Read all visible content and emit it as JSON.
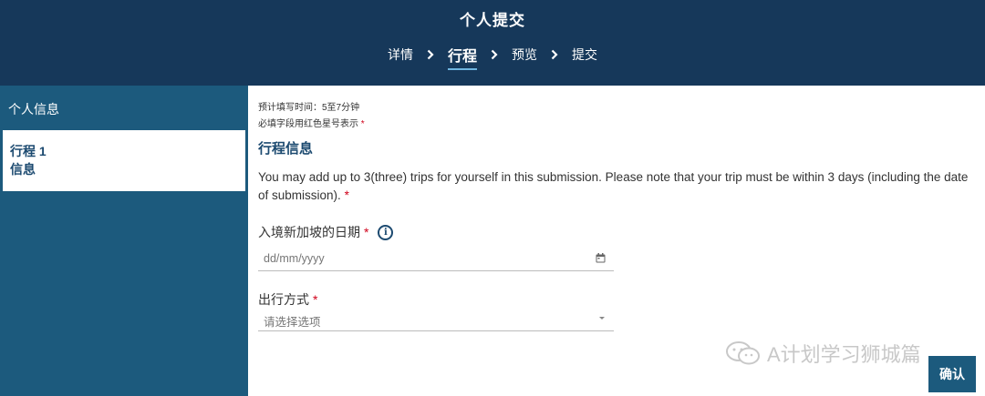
{
  "header": {
    "title": "个人提交",
    "steps": [
      {
        "label": "详情",
        "active": false
      },
      {
        "label": "行程",
        "active": true
      },
      {
        "label": "预览",
        "active": false
      },
      {
        "label": "提交",
        "active": false
      }
    ]
  },
  "sidebar": {
    "heading": "个人信息",
    "card": {
      "line1": "行程 1",
      "line2": "信息"
    }
  },
  "main": {
    "est_time": "预计填写时间：5至7分钟",
    "required_note": "必填字段用红色星号表示",
    "required_marker": "*",
    "section_title": "行程信息",
    "description": "You may add up to 3(three) trips for yourself in this submission. Please note that your trip must be within 3 days (including the date of submission).",
    "date_field": {
      "label": "入境新加坡的日期",
      "placeholder": "dd/mm/yyyy",
      "info_glyph": "i"
    },
    "travel_field": {
      "label": "出行方式",
      "placeholder": "请选择选项"
    }
  },
  "watermark": {
    "text": "A计划学习狮城篇"
  },
  "confirm_button": {
    "label": "确认"
  },
  "colors": {
    "header_bg": "#16385a",
    "sidebar_bg": "#1c5a7d",
    "accent": "#1c4a70",
    "required": "#d0021b"
  }
}
